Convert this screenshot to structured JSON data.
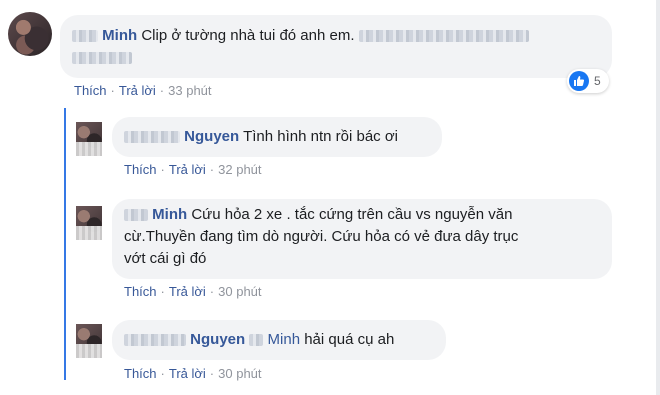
{
  "comments": [
    {
      "name": "Minh",
      "text": "Clip ở tường nhà tui đó anh em.",
      "actions": {
        "like": "Thích",
        "reply": "Trả lời",
        "time": "33 phút"
      },
      "reaction_count": "5",
      "reaction_icon": "like-icon",
      "reaction_color": "#1877f2"
    },
    {
      "name": "Nguyen",
      "text": "Tình hình ntn rồi bác ơi",
      "actions": {
        "like": "Thích",
        "reply": "Trả lời",
        "time": "32 phút"
      }
    },
    {
      "name": "Minh",
      "text_lines": [
        "Cứu hỏa 2 xe . tắc cứng trên cầu vs nguyễn văn",
        "cừ.Thuyền đang tìm dò người. Cứu hỏa có vẻ đưa dây trục",
        "vớt cái gì đó"
      ],
      "actions": {
        "like": "Thích",
        "reply": "Trả lời",
        "time": "30 phút"
      }
    },
    {
      "name": "Nguyen",
      "mention": "Minh",
      "text": "hải quá cụ ah",
      "actions": {
        "like": "Thích",
        "reply": "Trả lời",
        "time": "30 phút"
      }
    }
  ],
  "colors": {
    "name": "#365899",
    "bubble": "#f2f3f5",
    "thread": "#3578e5"
  }
}
